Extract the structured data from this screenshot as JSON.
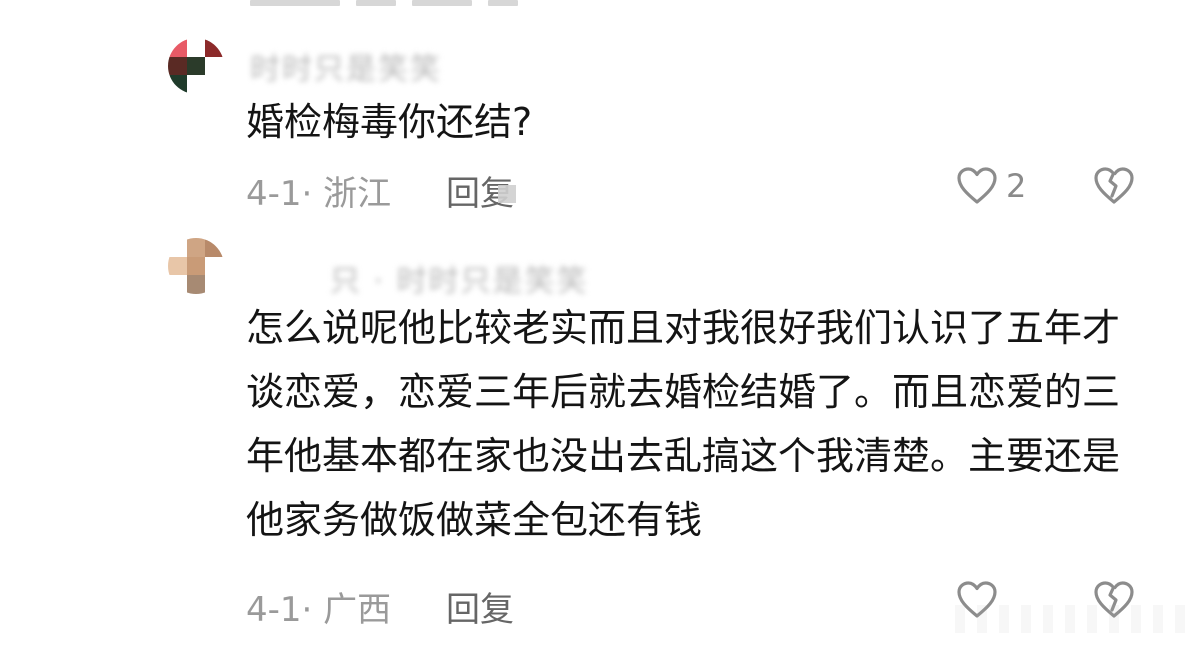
{
  "comments": [
    {
      "username": "时时只是笑笑",
      "text": "婚检梅毒你还结?",
      "meta": "4-1· 浙江",
      "reply_label": "回复",
      "like_count": "2",
      "avatar_colors": [
        "#e85a66",
        "#ffffff",
        "#8c2a2a",
        "#5a2a24",
        "#2b3b2a",
        "#ffffff",
        "#1f3b2b",
        "#ffffff",
        "#ffffff"
      ]
    },
    {
      "username": "只 · 时时只是笑笑",
      "text": "怎么说呢他比较老实而且对我很好我们认识了五年才谈恋爱，恋爱三年后就去婚检结婚了。而且恋爱的三年他基本都在家也没出去乱搞这个我清楚。主要还是他家务做饭做菜全包还有钱",
      "meta": "4-1· 广西",
      "reply_label": "回复",
      "like_count": "",
      "avatar_colors": [
        "#ffffff",
        "#cfa584",
        "#b88a6a",
        "#e8c6a8",
        "#c99b77",
        "#ffffff",
        "#ffffff",
        "#a78a73",
        "#ffffff"
      ]
    }
  ],
  "icons": {
    "like": "heart-icon",
    "dislike": "broken-heart-icon"
  }
}
